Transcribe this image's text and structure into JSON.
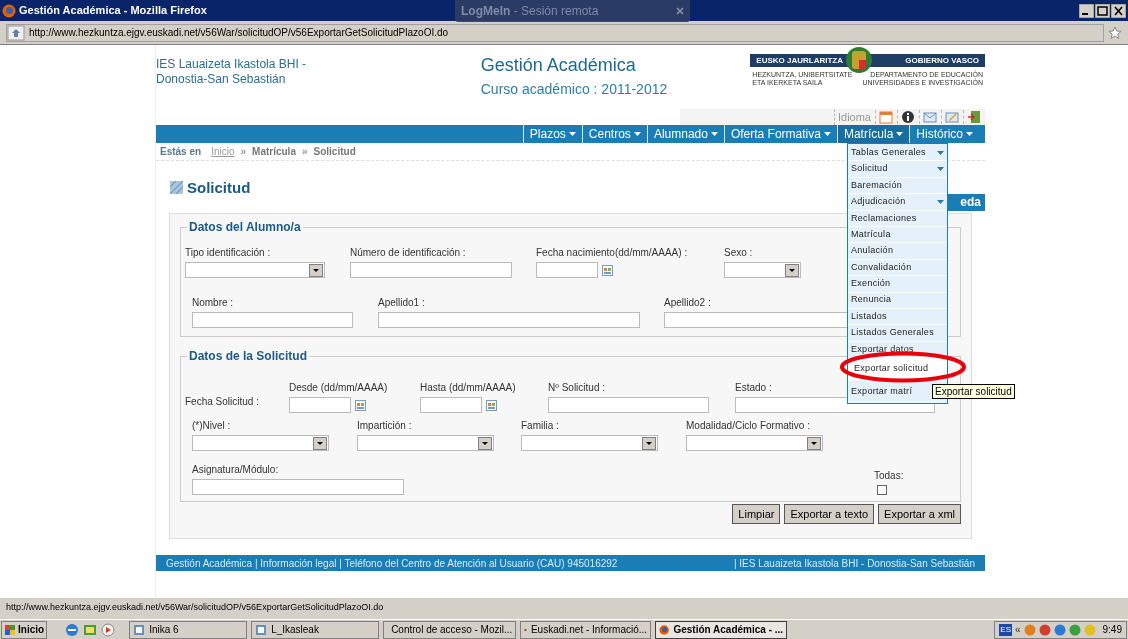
{
  "window": {
    "title": "Gestión Académica - Mozilla Firefox"
  },
  "remote_tab": {
    "title": "**LogMeIn** - Sesión remota"
  },
  "address_bar": {
    "url": "http://www.hezkuntza.ejgv.euskadi.net/v56War/solicitudOP/v56ExportarGetSolicitudPlazoOI.do"
  },
  "header": {
    "school": "IES Lauaizeta Ikastola BHI - Donostia-San Sebastián",
    "app_title": "Gestión Académica",
    "course": "Curso académico : 2011-2012",
    "logo": {
      "left": "EUSKO JAURLARITZA",
      "right": "GOBIERNO VASCO",
      "left_sub": "HEZKUNTZA, UNIBERTSITATE ETA IKERKETA SAILA",
      "right_sub": "DEPARTAMENTO DE EDUCACIÓN UNIVERSIDADES E INVESTIGACIÓN"
    }
  },
  "toolbar": {
    "language": "Idioma"
  },
  "nav": [
    {
      "label": "Plazos",
      "selected": false
    },
    {
      "label": "Centros",
      "selected": false
    },
    {
      "label": "Alumnado",
      "selected": false
    },
    {
      "label": "Oferta Formativa",
      "selected": false
    },
    {
      "label": "Matrícula",
      "selected": true
    },
    {
      "label": "Histórico",
      "selected": false
    }
  ],
  "breadcrumb": {
    "prefix": "Estás en",
    "separator": "»",
    "items": [
      "Inicio",
      "Matrícula",
      "Solicitud"
    ]
  },
  "page_title": "Solicitud",
  "tab_fragment": "eda",
  "sections": [
    {
      "legend": "Datos del Alumno/a",
      "rows": [
        {
          "fields": [
            {
              "kind": "select",
              "label": "Tipo identificación :"
            },
            {
              "kind": "text",
              "label": "Número de identificación :"
            },
            {
              "kind": "date",
              "label": "Fecha nacimiento(dd/mm/AAAA) :"
            },
            {
              "kind": "select",
              "label": "Sexo :"
            }
          ]
        },
        {
          "fields": [
            {
              "kind": "text",
              "label": "Nombre :"
            },
            {
              "kind": "text",
              "label": "Apellido1 :"
            },
            {
              "kind": "text",
              "label": "Apellido2 :"
            }
          ]
        }
      ]
    },
    {
      "legend": "Datos de la Solicitud",
      "rows": [
        {
          "fields": [
            {
              "kind": "label",
              "label": "Fecha Solicitud :"
            },
            {
              "kind": "date",
              "label": "Desde (dd/mm/AAAA)"
            },
            {
              "kind": "date",
              "label": "Hasta (dd/mm/AAAA)"
            },
            {
              "kind": "text",
              "label": "Nº Solicitud :"
            },
            {
              "kind": "text",
              "label": "Estado :"
            }
          ]
        },
        {
          "fields": [
            {
              "kind": "select",
              "label": "(*)Nivel :"
            },
            {
              "kind": "select",
              "label": "Impartición :"
            },
            {
              "kind": "select",
              "label": "Familia :"
            },
            {
              "kind": "select",
              "label": "Modalidad/Ciclo Formativo :"
            }
          ]
        },
        {
          "fields": [
            {
              "kind": "text",
              "label": "Asignatura/Módulo:"
            },
            {
              "kind": "checkbox",
              "label": "Todas:",
              "checked": false
            }
          ]
        }
      ]
    }
  ],
  "buttons": [
    "Limpiar",
    "Exportar a texto",
    "Exportar a xml"
  ],
  "footer": {
    "left": "Gestión Académica | Información legal | Teléfono del Centro de Atención al Usuario (CAU) 945016292",
    "right": "| IES Lauaizeta Ikastola BHI - Donostia-San Sebastián"
  },
  "menu": [
    {
      "label": "Tablas Generales",
      "submenu": true,
      "hovered": false
    },
    {
      "label": "Solicitud",
      "submenu": true,
      "hovered": false
    },
    {
      "label": "Baremación",
      "submenu": false,
      "hovered": false
    },
    {
      "label": "Adjudicación",
      "submenu": true,
      "hovered": false
    },
    {
      "label": "Reclamaciones",
      "submenu": false,
      "hovered": false
    },
    {
      "label": "Matrícula",
      "submenu": false,
      "hovered": false
    },
    {
      "label": "Anulación",
      "submenu": false,
      "hovered": false
    },
    {
      "label": "Convalidación",
      "submenu": false,
      "hovered": false
    },
    {
      "label": "Exención",
      "submenu": false,
      "hovered": false
    },
    {
      "label": "Renuncia",
      "submenu": false,
      "hovered": false
    },
    {
      "label": "Listados",
      "submenu": false,
      "hovered": false
    },
    {
      "label": "Listados Generales",
      "submenu": false,
      "hovered": false
    },
    {
      "label": "Exportar datos",
      "submenu": false,
      "hovered": false
    },
    {
      "label": "Exportar solicitud",
      "submenu": false,
      "hovered": true
    },
    {
      "label": "Exportar matrí",
      "submenu": false,
      "hovered": false
    }
  ],
  "tooltip": "Exportar solicitud",
  "status_bar": {
    "url": "http://www.hezkuntza.ejgv.euskadi.net/v56War/solicitudOP/v56ExportarGetSolicitudPlazoOI.do"
  },
  "taskbar": {
    "start": "Inicio",
    "tasks": [
      {
        "label": "Inika 6",
        "selected": false
      },
      {
        "label": "L_Ikasleak",
        "selected": false
      },
      {
        "label": "Control de acceso - Mozil...",
        "selected": false
      },
      {
        "label": "Euskadi.net - Informació...",
        "selected": false
      },
      {
        "label": "Gestión Académica - ...",
        "selected": true
      }
    ],
    "language": "ES",
    "expand": "«",
    "clock": "9:49"
  }
}
